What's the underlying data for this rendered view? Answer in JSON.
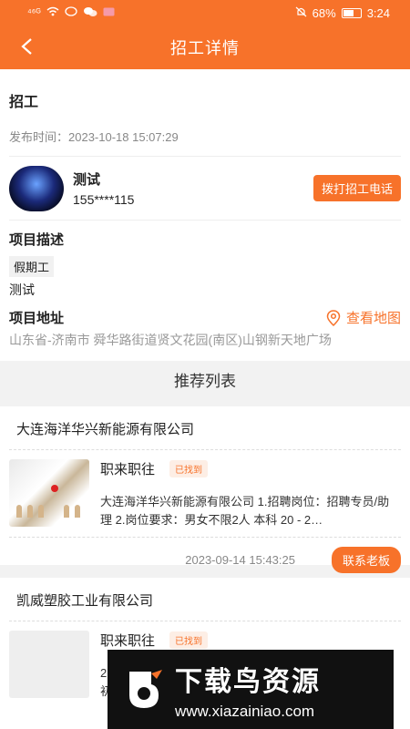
{
  "statusbar": {
    "signal": "⁴⁶ᴳ",
    "battery": "68%",
    "time": "3:24",
    "battery_level": 0.68
  },
  "header": {
    "title": "招工详情"
  },
  "detail": {
    "heading": "招工",
    "publish_time": "发布时间：2023-10-18 15:07:29",
    "user": {
      "name": "测试",
      "phone": "155****115"
    },
    "call_label": "拨打招工电话",
    "desc_title": "项目描述",
    "tag": "假期工",
    "desc": "测试",
    "addr_title": "项目地址",
    "map_label": "查看地图",
    "address": "山东省-济南市 舜华路街道贤文花园(南区)山钢新天地广场"
  },
  "recommend_title": "推荐列表",
  "jobs": [
    {
      "company": "大连海洋华兴新能源有限公司",
      "name": "职来职往",
      "status": "已找到",
      "desc": "大连海洋华兴新能源有限公司 1.招聘岗位：招聘专员/助理 2.岗位要求：男女不限2人 本科 20 - 2…",
      "time": "2023-09-14 15:43:25",
      "contact_label": "联系老板"
    },
    {
      "company": "凯威塑胶工业有限公司",
      "name": "职来职往",
      "status": "已找到",
      "desc": "2…",
      "desc2": "初"
    }
  ],
  "watermark": {
    "title": "下载鸟资源",
    "url": "www.xiazainiao.com"
  },
  "colors": {
    "accent": "#f7722a"
  }
}
